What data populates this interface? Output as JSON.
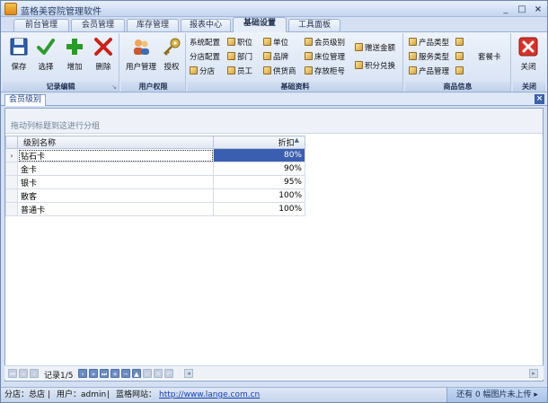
{
  "app": {
    "title": "蓝格美容院管理软件"
  },
  "window_controls": {
    "minimize": "_",
    "maximize": "□",
    "close": "×"
  },
  "tabs": [
    "前台管理",
    "会员管理",
    "库存管理",
    "报表中心",
    "基础设置",
    "工具面板"
  ],
  "active_tab": "基础设置",
  "ribbon": {
    "groups": {
      "record_edit": "记录编辑",
      "user_perm": "用户权限",
      "basic_data": "基础资料",
      "product_info": "商品信息",
      "close": "关闭"
    },
    "record_buttons": {
      "save": "保存",
      "select": "选择",
      "add": "增加",
      "delete": "删除"
    },
    "user_buttons": {
      "user_mgmt": "用户管理",
      "grant": "授权"
    },
    "basic_items": {
      "system_config": "系统配置",
      "branch_config": "分店配置",
      "branch": "分店",
      "position": "职位",
      "department": "部门",
      "employee": "员工",
      "unit": "单位",
      "brand": "品牌",
      "supplier": "供货商",
      "member_level": "会员级别",
      "bed_mgmt": "床位管理",
      "storage_cabinet": "存放柜号",
      "gift_amount": "赠送金额",
      "points_exchange": "积分兑换"
    },
    "product_items": {
      "product_type": "产品类型",
      "service_type": "服务类型",
      "product_mgmt": "产品管理",
      "package_card": "套餐卡"
    },
    "close_button": "关闭",
    "launcher": "↘"
  },
  "document_tab": {
    "label": "会员级别",
    "close": "×"
  },
  "grid": {
    "group_hint": "拖动列标题到这进行分组",
    "columns": [
      "级别名称",
      "折扣"
    ],
    "sort_indicator": "▲",
    "row_indicator": "›",
    "rows": [
      {
        "name": "钻石卡",
        "discount": "80%"
      },
      {
        "name": "金卡",
        "discount": "90%"
      },
      {
        "name": "银卡",
        "discount": "95%"
      },
      {
        "name": "散客",
        "discount": "100%"
      },
      {
        "name": "普通卡",
        "discount": "100%"
      }
    ],
    "selected_index": 0
  },
  "navigator": {
    "record_text": "记录1/5",
    "buttons": [
      "⏮",
      "«",
      "‹",
      "›",
      "»",
      "⏭",
      "+",
      "−",
      "▲",
      "✓",
      "✕",
      "↶"
    ]
  },
  "status": {
    "branch": "分店：总店",
    "user": "用户：admin",
    "site_label": "蓝格网站：",
    "site_url": "http://www.lange.com.cn",
    "sep": "|",
    "upload_msg": "还有 0 幅图片未上传 ▸"
  },
  "colors": {
    "accent": "#3b5fb0",
    "ribbon": "#d5e1f3",
    "title": "#2a3f66"
  },
  "icons": {
    "save": "floppy-icon",
    "select": "check-icon",
    "add": "plus-icon",
    "delete": "x-icon",
    "user_mgmt": "users-icon",
    "grant": "key-icon",
    "close": "close-icon"
  }
}
